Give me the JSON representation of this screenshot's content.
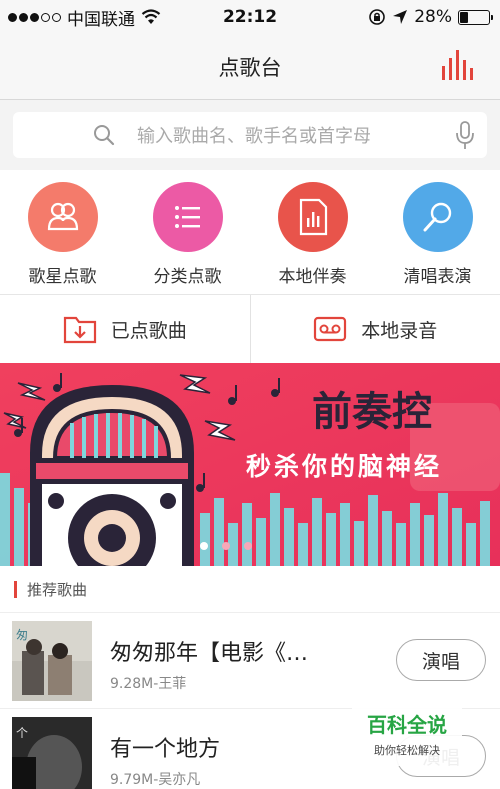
{
  "status_bar": {
    "carrier": "中国联通",
    "time": "22:12",
    "battery_text": "28%",
    "battery_level": 0.28,
    "signal_bars_filled": 3,
    "signal_bars_total": 5
  },
  "nav": {
    "title": "点歌台",
    "eq_icon": "equalizer-icon",
    "accent_color": "#e2453c"
  },
  "search": {
    "placeholder": "输入歌曲名、歌手名或首字母",
    "search_icon": "search-icon",
    "mic_icon": "microphone-icon"
  },
  "categories": [
    {
      "label": "歌星点歌",
      "color": "#f47b6b",
      "icon": "singer-icon"
    },
    {
      "label": "分类点歌",
      "color": "#ec5aa5",
      "icon": "list-icon"
    },
    {
      "label": "本地伴奏",
      "color": "#e8544b",
      "icon": "audio-file-icon"
    },
    {
      "label": "清唱表演",
      "color": "#52a9e8",
      "icon": "microphone-icon"
    }
  ],
  "quick_actions": [
    {
      "label": "已点歌曲",
      "icon": "download-folder-icon"
    },
    {
      "label": "本地录音",
      "icon": "tape-icon"
    }
  ],
  "banner": {
    "headline": "前奏控",
    "subline": "秒杀你的脑神经",
    "page_count": 3,
    "active_page": 1
  },
  "recommended": {
    "section_title": "推荐歌曲",
    "songs": [
      {
        "title": "匆匆那年【电影《…",
        "meta": "9.28M-王菲",
        "button": "演唱"
      },
      {
        "title": "有一个地方",
        "meta": "9.79M-吴亦凡",
        "button": "演唱"
      }
    ]
  },
  "watermark": {
    "main": "百科全说",
    "sub": "助你轻松解决"
  }
}
